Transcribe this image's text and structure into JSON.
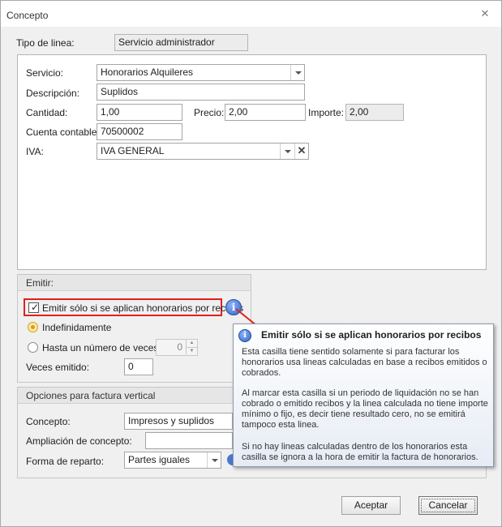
{
  "window": {
    "title": "Concepto"
  },
  "tipo_linea": {
    "label": "Tipo de linea:",
    "value": "Servicio administrador"
  },
  "form": {
    "servicio": {
      "label": "Servicio:",
      "value": "Honorarios Alquileres"
    },
    "descripcion": {
      "label": "Descripción:",
      "value": "Suplidos"
    },
    "cantidad": {
      "label": "Cantidad:",
      "value": "1,00"
    },
    "precio": {
      "label": "Precio:",
      "value": "2,00"
    },
    "importe": {
      "label": "Importe:",
      "value": "2,00"
    },
    "cuenta": {
      "label": "Cuenta contable:",
      "value": "70500002"
    },
    "iva": {
      "label": "IVA:",
      "value": "IVA GENERAL"
    }
  },
  "emitir": {
    "title": "Emitir:",
    "checkbox_label": "Emitir sólo si se aplican honorarios por recibos",
    "checked": true,
    "radio_indef": "Indefinidamente",
    "radio_hasta": "Hasta un número de veces",
    "hasta_value": "0",
    "veces_label": "Veces emitido:",
    "veces_value": "0"
  },
  "opciones": {
    "title": "Opciones para factura vertical",
    "concepto_label": "Concepto:",
    "concepto_value": "Impresos y suplidos",
    "ampliacion_label": "Ampliación de concepto:",
    "ampliacion_value": "",
    "reparto_label": "Forma de reparto:",
    "reparto_value": "Partes iguales"
  },
  "tooltip": {
    "title": "Emitir sólo si se aplican honorarios por recibos",
    "p1": "Esta casilla tiene sentido solamente si para facturar los honorarios usa lineas calculadas en base a recibos emitidos o cobrados.",
    "p2": "Al marcar esta casilla si un periodo de liquidación no se han cobrado o emitido recibos y la linea calculada no tiene importe mínimo o fijo, es decir tiene resultado cero, no se emitirá tampoco esta linea.",
    "p3": "Si no hay lineas calculadas dentro de los honorarios esta casilla se ignora a la hora de emitir la factura de honorarios."
  },
  "buttons": {
    "aceptar": "Aceptar",
    "cancelar": "Cancelar"
  },
  "icons": {
    "info": "info-icon",
    "close": "close-icon"
  },
  "colors": {
    "highlight_red": "#e02020",
    "info_blue": "#2f62c8"
  }
}
